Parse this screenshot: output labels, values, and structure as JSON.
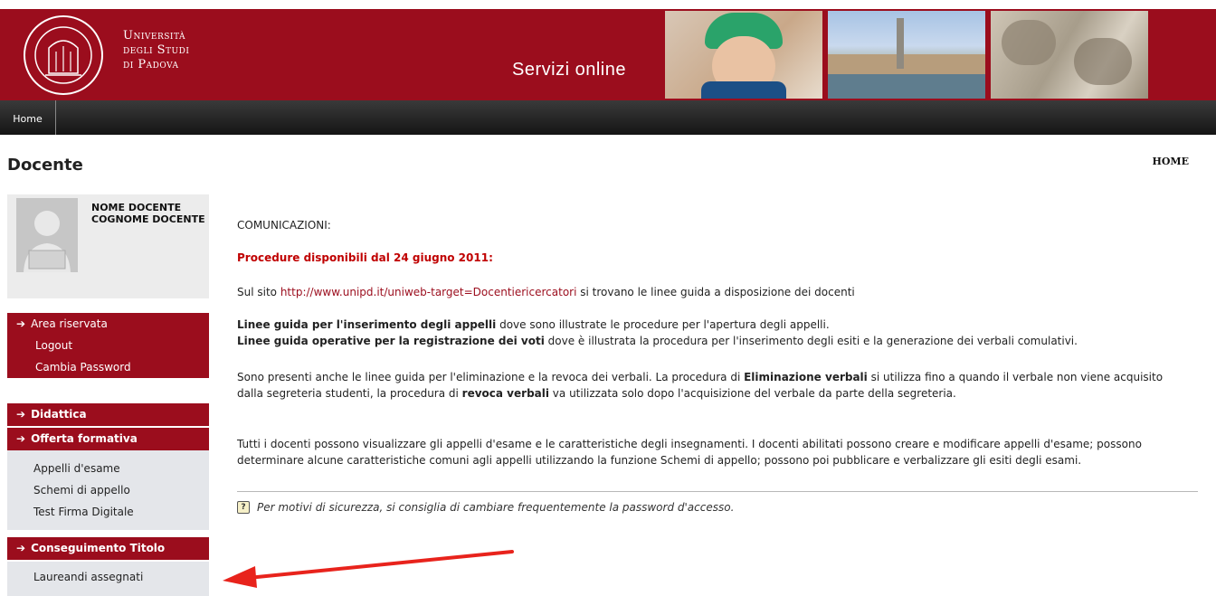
{
  "header": {
    "university": [
      "Università",
      "degli Studi",
      "di Padova"
    ],
    "service_title": "Servizi online"
  },
  "nav": {
    "home": "Home"
  },
  "page": {
    "title": "Docente",
    "breadcrumb": "HOME"
  },
  "profile": {
    "name": "NOME DOCENTE",
    "surname": "COGNOME DOCENTE"
  },
  "reserved": {
    "title": "Area riservata",
    "items": [
      "Logout",
      "Cambia Password"
    ]
  },
  "menu": {
    "didattica": "Didattica",
    "offerta": {
      "title": "Offerta formativa",
      "items": [
        "Appelli d'esame",
        "Schemi di appello",
        "Test Firma Digitale"
      ]
    },
    "conseguimento": {
      "title": "Conseguimento Titolo",
      "items": [
        "Laureandi assegnati"
      ]
    }
  },
  "content": {
    "comunicazioni": "COMUNICAZIONI:",
    "procedure": "Procedure disponibili dal 24 giugno 2011:",
    "site_pre": "Sul sito ",
    "site_link": "http://www.unipd.it/uniweb-target=Docentiericercatori",
    "site_post": " si trovano le linee guida a disposizione dei docenti",
    "guide1_bold": "Linee guida per l'inserimento degli appelli",
    "guide1_rest": " dove sono illustrate le procedure per l'apertura degli appelli.",
    "guide2_bold": "Linee guida operative per la registrazione dei voti",
    "guide2_rest": " dove è illustrata la procedura per l'inserimento degli esiti e la generazione dei verbali comulativi.",
    "p3_a": "Sono presenti anche le linee guida per l'eliminazione e la revoca dei verbali. La procedura di ",
    "p3_b": "Eliminazione verbali",
    "p3_c": " si utilizza fino a quando il verbale non viene acquisito",
    "p3_d": "dalla segreteria studenti, la procedura di ",
    "p3_e": "revoca verbali",
    "p3_f": " va utilizzata solo dopo l'acquisizione del verbale da parte della segreteria.",
    "p4_line1": "Tutti i docenti possono visualizzare gli appelli d'esame e le caratteristiche degli insegnamenti. I docenti abilitati possono creare e modificare appelli d'esame; possono",
    "p4_line2": "determinare alcune caratteristiche comuni agli appelli utilizzando la funzione Schemi di appello; possono poi pubblicare e verbalizzare gli esiti degli esami.",
    "security_note": "Per motivi di sicurezza, si consiglia di cambiare frequentemente la password d'accesso."
  },
  "colors": {
    "brand": "#9b0d1d",
    "annotation_arrow": "#e8231c"
  }
}
